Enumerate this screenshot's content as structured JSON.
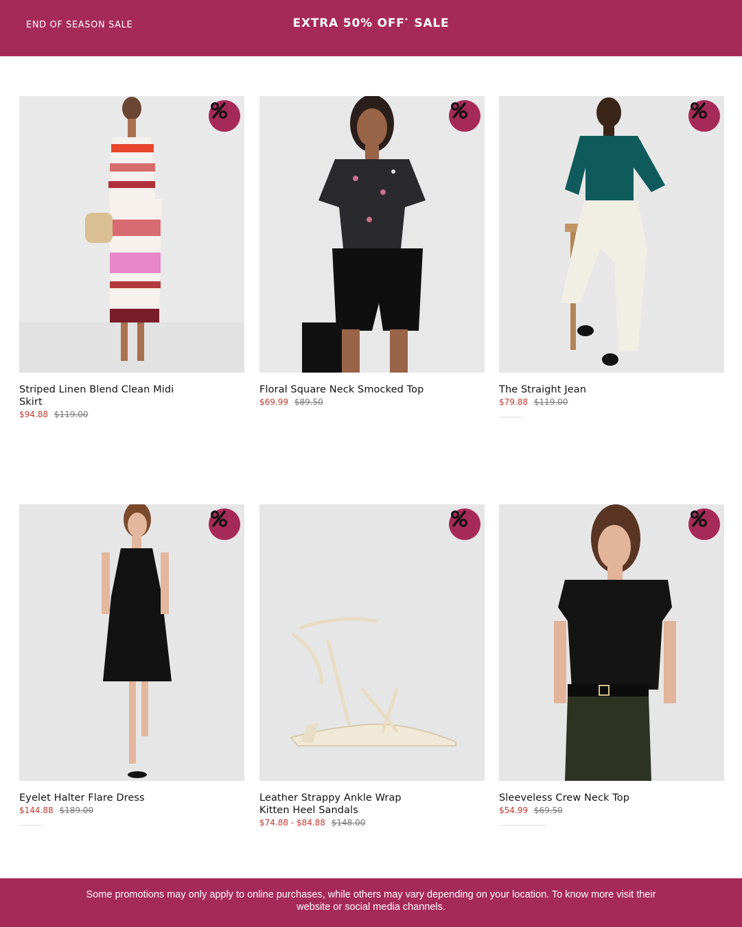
{
  "promo_bar": {
    "left_label": "END OF SEASON SALE",
    "headline": "EXTRA 50% OFF",
    "headline_mark": "*",
    "headline_suffix": "SALE",
    "background": "#a62a58"
  },
  "products": [
    {
      "name": "Striped Linen Blend Clean Midi Skirt",
      "sale_price": "$94.88",
      "original_price": "$119.00",
      "badge_icon": "percent-icon"
    },
    {
      "name": "Floral Square Neck Smocked Top",
      "sale_price": "$69.99",
      "original_price": "$89.50",
      "badge_icon": "percent-icon"
    },
    {
      "name": "The Straight Jean",
      "sale_price": "$79.88",
      "original_price": "$119.00",
      "badge_icon": "percent-icon"
    },
    {
      "name": "Eyelet Halter Flare Dress",
      "sale_price": "$144.88",
      "original_price": "$189.00",
      "badge_icon": "percent-icon"
    },
    {
      "name": "Leather Strappy Ankle Wrap Kitten Heel Sandals",
      "sale_price": "$74.88 - $84.88",
      "original_price": "$148.00",
      "badge_icon": "percent-icon"
    },
    {
      "name": "Sleeveless Crew Neck Top",
      "sale_price": "$54.99",
      "original_price": "$69.50",
      "badge_icon": "percent-icon"
    }
  ],
  "footer": {
    "disclaimer": "Some promotions may only apply to online purchases, while others may vary depending on your location. To know more visit their website or social media channels."
  },
  "colors": {
    "brand": "#a62a58",
    "sale_price": "#c8372d",
    "original_price": "#777777"
  }
}
